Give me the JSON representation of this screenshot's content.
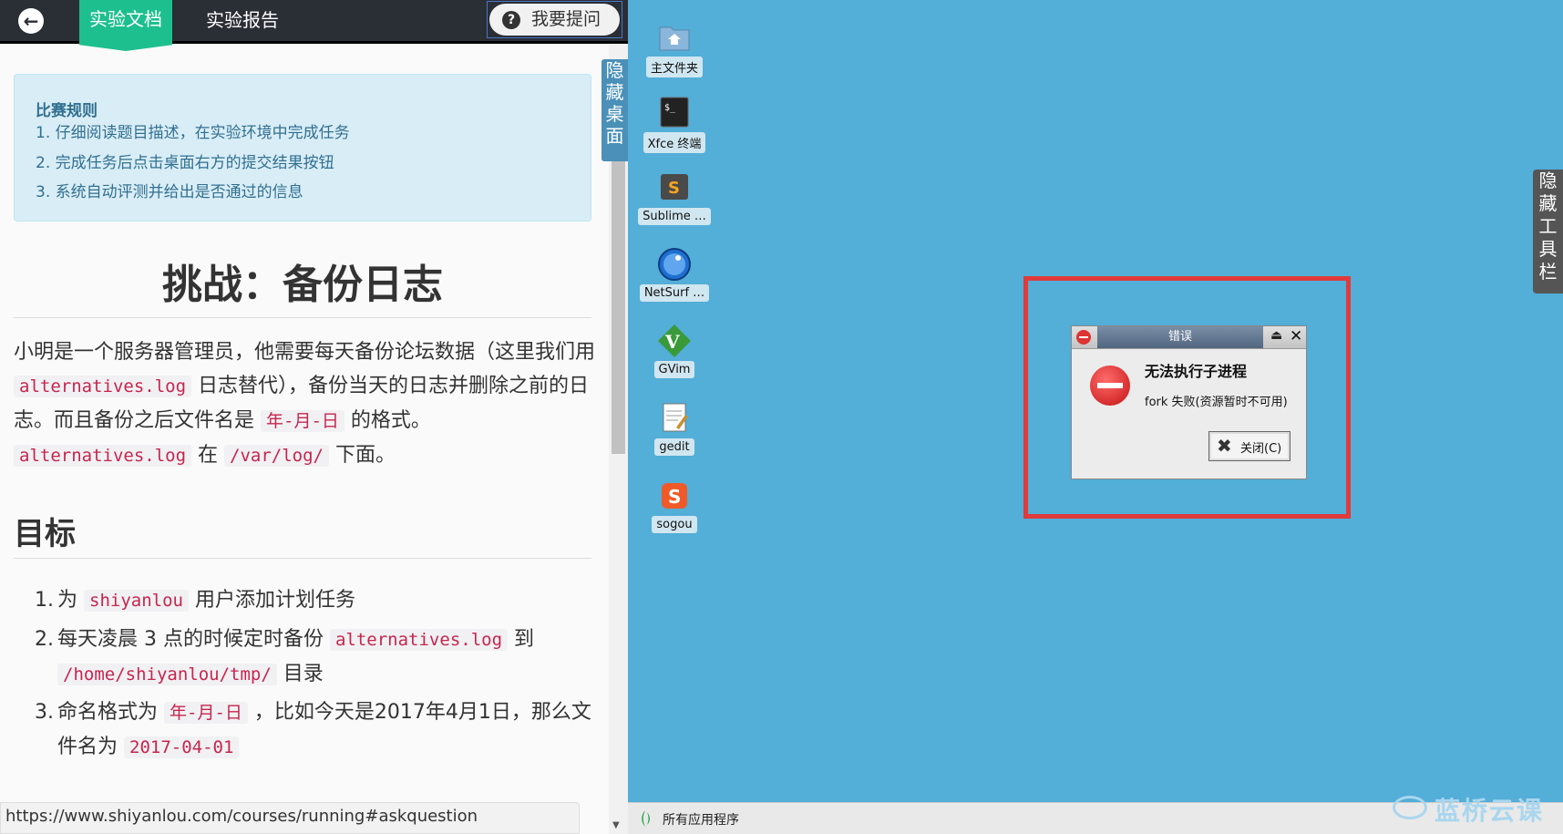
{
  "topbar": {
    "back_icon": "arrow-left-icon",
    "tab_doc": "实验文档",
    "tab_report": "实验报告",
    "ask_button": "我要提问",
    "ask_icon": "?"
  },
  "rules": {
    "title": "比赛规则",
    "items": [
      "1. 仔细阅读题目描述，在实验环境中完成任务",
      "2. 完成任务后点击桌面右方的提交结果按钮",
      "3. 系统自动评测并给出是否通过的信息"
    ]
  },
  "article": {
    "title": "挑战：备份日志",
    "intro": {
      "t1": "小明是一个服务器管理员，他需要每天备份论坛数据（这里我们用",
      "c1": "alternatives.log",
      "t2": "日志替代），备份当天的日志并删除之前的日志。而且备份之后文件名是",
      "c2": "年-月-日",
      "t3": "的格式。",
      "c3": "alternatives.log",
      "t4": "在",
      "c4": "/var/log/",
      "t5": "下面。"
    },
    "goal_title": "目标",
    "goals": [
      {
        "num": "1.",
        "t1": "为",
        "c1": "shiyanlou",
        "t2": "用户添加计划任务"
      },
      {
        "num": "2.",
        "t1": "每天凌晨 3 点的时候定时备份",
        "c1": "alternatives.log",
        "t2": "到",
        "c2": "/home/shiyanlou/tmp/",
        "t3": "目录"
      },
      {
        "num": "3.",
        "t1": "命名格式为",
        "c1": "年-月-日",
        "t2": "，比如今天是2017年4月1日，那么文件名为",
        "c2": "2017-04-01"
      }
    ]
  },
  "hide_desktop": "隐藏桌面",
  "status_url": "https://www.shiyanlou.com/courses/running#askquestion",
  "desktop": {
    "icons": [
      {
        "label": "主文件夹",
        "icon": "home-folder-icon"
      },
      {
        "label": "Xfce 终端",
        "icon": "terminal-icon"
      },
      {
        "label": "Sublime …",
        "icon": "sublime-icon"
      },
      {
        "label": "NetSurf …",
        "icon": "netsurf-icon"
      },
      {
        "label": "GVim",
        "icon": "gvim-icon"
      },
      {
        "label": "gedit",
        "icon": "gedit-icon"
      },
      {
        "label": "sogou",
        "icon": "sogou-icon"
      }
    ],
    "hide_toolbar": "隐藏工具栏"
  },
  "dialog": {
    "title": "错误",
    "heading": "无法执行子进程",
    "message": "fork 失败(资源暂时不可用)",
    "close_label": "关闭(C)",
    "accent": "#e03a3a"
  },
  "taskbar": {
    "apps_label": "所有应用程序"
  },
  "watermark": "蓝桥云课"
}
